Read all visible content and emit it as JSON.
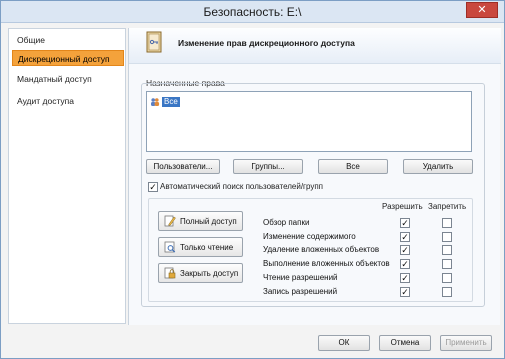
{
  "window": {
    "title": "Безопасность: E:\\",
    "close_label": "✕"
  },
  "sidebar": {
    "items": [
      {
        "label": "Общие",
        "active": false
      },
      {
        "label": "Дискреционный доступ",
        "active": true
      },
      {
        "label": "Мандатный доступ",
        "active": false
      },
      {
        "label": "Аудит доступа",
        "active": false
      }
    ]
  },
  "header": {
    "title": "Изменение прав дискреционного доступа"
  },
  "rights": {
    "group_label": "Назначенные права",
    "list": [
      {
        "label": "Все",
        "selected": true
      }
    ],
    "buttons": {
      "users": "Пользователи...",
      "groups": "Группы...",
      "all": "Все",
      "delete": "Удалить"
    },
    "autosearch": {
      "label": "Автоматический поиск пользователей/групп",
      "checked": true
    }
  },
  "templates": {
    "full": "Полный доступ",
    "read": "Только чтение",
    "close": "Закрыть доступ"
  },
  "permissions": {
    "allow_header": "Разрешить",
    "deny_header": "Запретить",
    "rows": [
      {
        "label": "Обзор папки",
        "allow": true,
        "deny": false
      },
      {
        "label": "Изменение содержимого",
        "allow": true,
        "deny": false
      },
      {
        "label": "Удаление вложенных объектов",
        "allow": true,
        "deny": false
      },
      {
        "label": "Выполнение вложенных объектов",
        "allow": true,
        "deny": false
      },
      {
        "label": "Чтение разрешений",
        "allow": true,
        "deny": false
      },
      {
        "label": "Запись разрешений",
        "allow": true,
        "deny": false
      }
    ]
  },
  "footer": {
    "ok": "ОК",
    "cancel": "Отмена",
    "apply": "Применить"
  },
  "colors": {
    "accent": "#f4a23b",
    "selection": "#3a76c4",
    "titlebar": "#dbe6f3",
    "close": "#c9483e"
  }
}
